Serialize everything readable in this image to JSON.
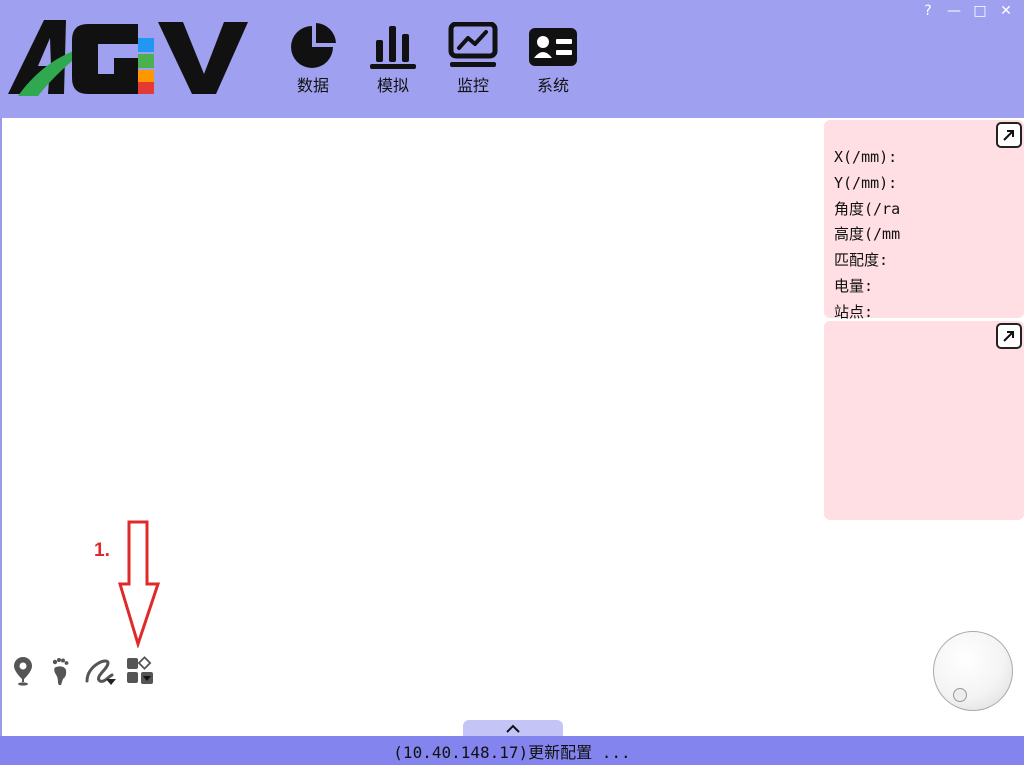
{
  "app": {
    "logo_text": "AGV",
    "window_controls": {
      "help": "?",
      "minimize": "—",
      "maximize": "□",
      "close": "✕"
    }
  },
  "nav": {
    "items": [
      {
        "label": "数据",
        "icon": "pie-chart-icon"
      },
      {
        "label": "模拟",
        "icon": "bar-chart-icon"
      },
      {
        "label": "监控",
        "icon": "monitor-chart-icon"
      },
      {
        "label": "系统",
        "icon": "id-card-icon"
      }
    ]
  },
  "info_panel": {
    "rows": [
      "X(/mm):",
      "Y(/mm):",
      "角度(/ra",
      "高度(/mm",
      "匹配度:",
      "电量:",
      "站点:"
    ]
  },
  "toolbar": {
    "tools": [
      "location-pin-icon",
      "footprints-icon",
      "path-draw-icon",
      "shapes-icon"
    ]
  },
  "annotation": {
    "label": "1."
  },
  "status": {
    "text": "(10.40.148.17)更新配置 ..."
  },
  "colors": {
    "header_bg": "#a0a0f0",
    "panel_bg": "#ffdfe3",
    "status_bg": "#8484ee",
    "annotation": "#e02a2a"
  }
}
